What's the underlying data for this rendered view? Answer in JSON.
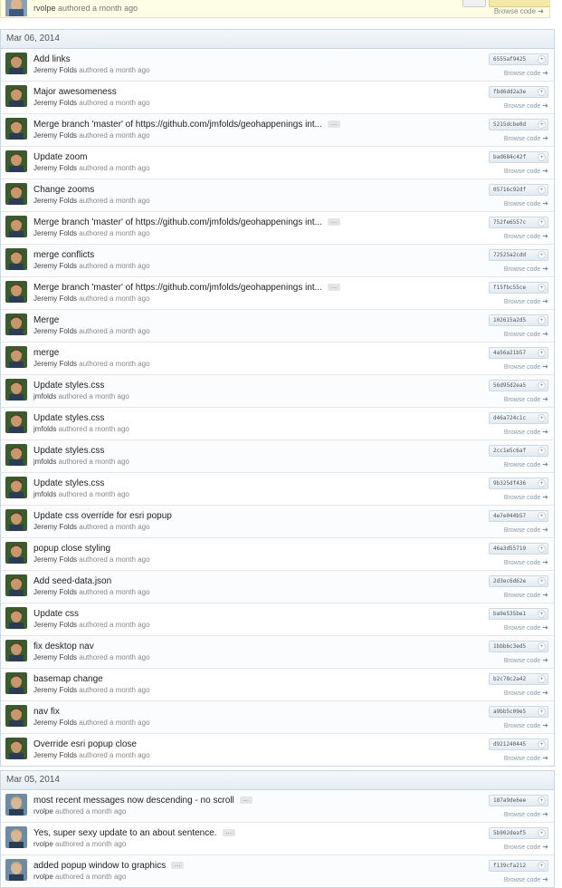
{
  "top_partial": {
    "author": "rvolpe",
    "authored_text": "authored a month ago",
    "browse_label": "Browse code"
  },
  "icons": {
    "more": "ellipsis-icon",
    "copy": "plus-icon",
    "browse": "arrow-right-icon"
  },
  "groups": [
    {
      "date": "Mar 06, 2014",
      "commits": [
        {
          "title": "Add links",
          "author": "Jeremy Folds",
          "authored": "authored a month ago",
          "sha": "6555af9425",
          "more": false
        },
        {
          "title": "Major awesomeness",
          "author": "Jeremy Folds",
          "authored": "authored a month ago",
          "sha": "fbd6dd2a3e",
          "more": false
        },
        {
          "title": "Merge branch 'master' of https://github.com/jmfolds/geohappenings int...",
          "author": "Jeremy Folds",
          "authored": "authored a month ago",
          "sha": "5215dcbe0d",
          "more": true
        },
        {
          "title": "Update zoom",
          "author": "Jeremy Folds",
          "authored": "authored a month ago",
          "sha": "bad684c42f",
          "more": false
        },
        {
          "title": "Change zooms",
          "author": "Jeremy Folds",
          "authored": "authored a month ago",
          "sha": "05716c92df",
          "more": false
        },
        {
          "title": "Merge branch 'master' of https://github.com/jmfolds/geohappenings int...",
          "author": "Jeremy Folds",
          "authored": "authored a month ago",
          "sha": "752fe6557c",
          "more": true
        },
        {
          "title": "merge conflicts",
          "author": "Jeremy Folds",
          "authored": "authored a month ago",
          "sha": "72525a2cdd",
          "more": false
        },
        {
          "title": "Merge branch 'master' of https://github.com/jmfolds/geohappenings int...",
          "author": "Jeremy Folds",
          "authored": "authored a month ago",
          "sha": "f15fbc55ce",
          "more": true
        },
        {
          "title": "Merge",
          "author": "Jeremy Folds",
          "authored": "authored a month ago",
          "sha": "102615a2d5",
          "more": false
        },
        {
          "title": "merge",
          "author": "Jeremy Folds",
          "authored": "authored a month ago",
          "sha": "4a56a21b57",
          "more": false
        },
        {
          "title": "Update styles.css",
          "author": "jmfolds",
          "authored": "authored a month ago",
          "sha": "56d95d2ea5",
          "more": false
        },
        {
          "title": "Update styles.css",
          "author": "jmfolds",
          "authored": "authored a month ago",
          "sha": "d46a724c1c",
          "more": false
        },
        {
          "title": "Update styles.css",
          "author": "jmfolds",
          "authored": "authored a month ago",
          "sha": "2cc1e5c6af",
          "more": false
        },
        {
          "title": "Update styles.css",
          "author": "jmfolds",
          "authored": "authored a month ago",
          "sha": "9b325df436",
          "more": false
        },
        {
          "title": "Update css override for esri popup",
          "author": "Jeremy Folds",
          "authored": "authored a month ago",
          "sha": "4e7e044b57",
          "more": false
        },
        {
          "title": "popup close styling",
          "author": "Jeremy Folds",
          "authored": "authored a month ago",
          "sha": "46a3d55719",
          "more": false
        },
        {
          "title": "Add seed-data.json",
          "author": "Jeremy Folds",
          "authored": "authored a month ago",
          "sha": "2d3ec6d62e",
          "more": false
        },
        {
          "title": "Update css",
          "author": "Jeremy Folds",
          "authored": "authored a month ago",
          "sha": "ba9e535be1",
          "more": false
        },
        {
          "title": "fix desktop nav",
          "author": "Jeremy Folds",
          "authored": "authored a month ago",
          "sha": "1bbb6c3ed5",
          "more": false
        },
        {
          "title": "basemap change",
          "author": "Jeremy Folds",
          "authored": "authored a month ago",
          "sha": "b2c78c2a42",
          "more": false
        },
        {
          "title": "nav fix",
          "author": "Jeremy Folds",
          "authored": "authored a month ago",
          "sha": "a9bb5c09e5",
          "more": false
        },
        {
          "title": "Override esri popup close",
          "author": "Jeremy Folds",
          "authored": "authored a month ago",
          "sha": "d921240445",
          "more": false
        }
      ]
    },
    {
      "date": "Mar 05, 2014",
      "commits": [
        {
          "title": "most recent messages now descending - no scroll",
          "author": "rvolpe",
          "authored": "authored a month ago",
          "sha": "187a9de6ee",
          "more": true
        },
        {
          "title": "Yes, super sexy update to an about sentence.",
          "author": "rvolpe",
          "authored": "authored a month ago",
          "sha": "5b902deaf5",
          "more": true
        },
        {
          "title": "added popup window to graphics",
          "author": "rvolpe",
          "authored": "authored a month ago",
          "sha": "f139cfa212",
          "more": true
        }
      ]
    }
  ],
  "browse_label": "Browse code"
}
